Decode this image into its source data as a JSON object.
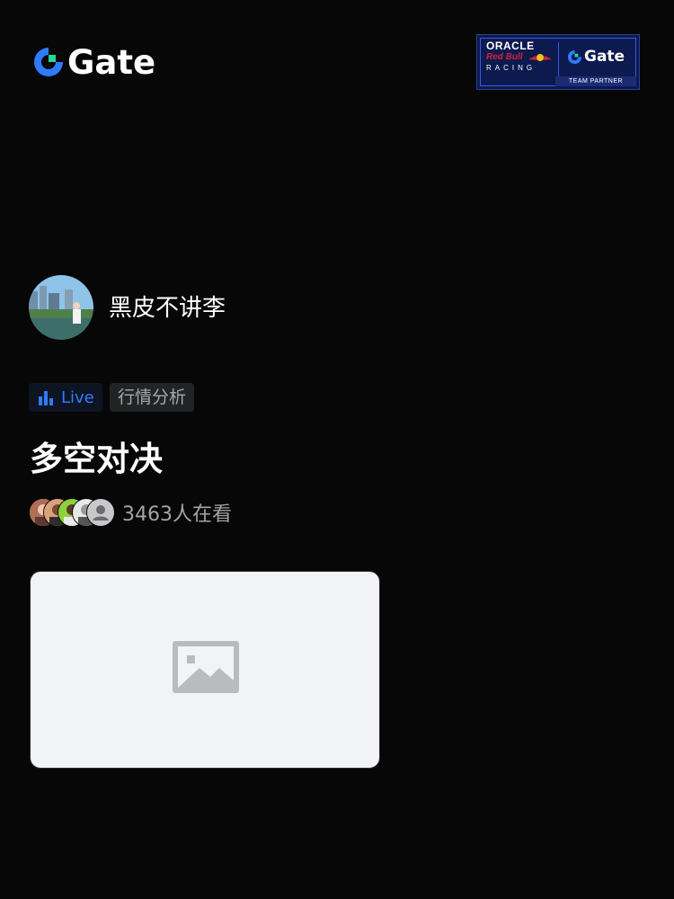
{
  "brand": {
    "logo_text": "Gate",
    "accent": "#2f7bff",
    "accent_green": "#2ad598"
  },
  "partner_badge": {
    "oracle": "ORACLE",
    "redbull": "Red Bull",
    "racing": "RACING",
    "gate_text": "Gate",
    "partner": "TEAM PARTNER"
  },
  "streamer": {
    "name": "黑皮不讲李"
  },
  "tags": {
    "live_label": "Live",
    "category": "行情分析"
  },
  "stream": {
    "title": "多空对决"
  },
  "viewers": {
    "count_text": "3463人在看"
  },
  "thumbnail": {
    "icon": "image-placeholder-icon"
  }
}
